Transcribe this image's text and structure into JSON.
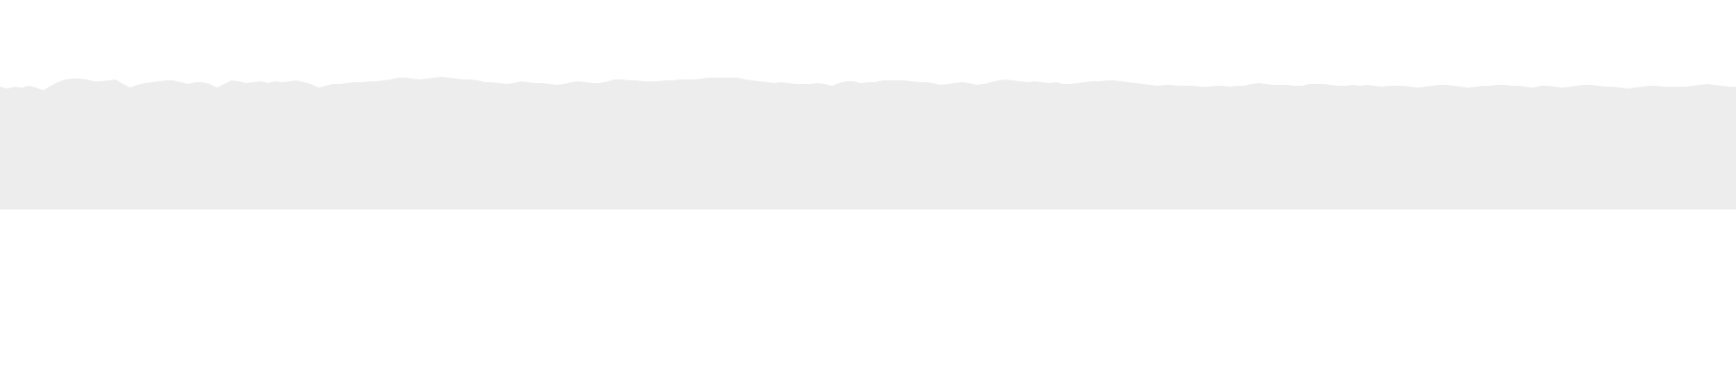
{
  "section_divider": {
    "fill_color": "#ededed",
    "background_color": "#ffffff",
    "shape": "torn-paper-edge",
    "repeat_count": 3
  }
}
